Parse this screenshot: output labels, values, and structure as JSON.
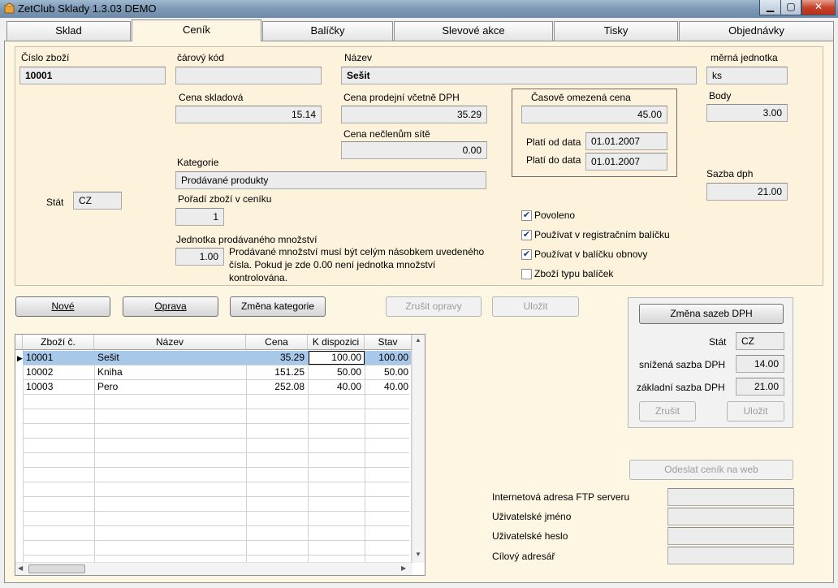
{
  "window": {
    "title": "ZetClub Sklady 1.3.03 DEMO"
  },
  "tabs": [
    "Sklad",
    "Ceník",
    "Balíčky",
    "Slevové akce",
    "Tisky",
    "Objednávky"
  ],
  "form": {
    "cislo_label": "Číslo zboží",
    "cislo_value": "10001",
    "carovy_label": "čárový kód",
    "carovy_value": "",
    "nazev_label": "Název",
    "nazev_value": "Sešit",
    "jednotka_label": "měrná jednotka",
    "jednotka_value": "ks",
    "cena_skladova_label": "Cena skladová",
    "cena_skladova_value": "15.14",
    "cena_prodejni_label": "Cena prodejní včetně DPH",
    "cena_prodejni_value": "35.29",
    "cena_necl_label": "Cena nečlenům sítě",
    "cena_necl_value": "0.00",
    "casove_label": "Časově omezená cena",
    "casove_value": "45.00",
    "plati_od_label": "Platí od data",
    "plati_od_value": "01.01.2007",
    "plati_do_label": "Platí do data",
    "plati_do_value": "01.01.2007",
    "body_label": "Body",
    "body_value": "3.00",
    "sazba_label": "Sazba dph",
    "sazba_value": "21.00",
    "kategorie_label": "Kategorie",
    "kategorie_value": "Prodávané produkty",
    "stat_label": "Stát",
    "stat_value": "CZ",
    "poradi_label": "Pořadí zboží v ceníku",
    "poradi_value": "1",
    "jpm_label": "Jednotka prodávaného množství",
    "jpm_value": "1.00",
    "jpm_note": "Prodávané množství musí být celým násobkem uvedeného čísla. Pokud je zde 0.00 není jednotka množství kontrolována.",
    "checkboxes": [
      {
        "label": "Povoleno",
        "checked": true
      },
      {
        "label": "Používat v registračním balíčku",
        "checked": true
      },
      {
        "label": "Používat v balíčku obnovy",
        "checked": true
      },
      {
        "label": "Zboží typu balíček",
        "checked": false
      }
    ]
  },
  "buttons": {
    "nove": "Nové",
    "oprava": "Oprava",
    "zmena_kategorie": "Změna kategorie",
    "zrusit_opravy": "Zrušit opravy",
    "ulozit": "Uložit"
  },
  "grid": {
    "columns": [
      "Zboží č.",
      "Název",
      "Cena",
      "K dispozici",
      "Stav"
    ],
    "rows": [
      [
        "10001",
        "Sešit",
        "35.29",
        "100.00",
        "100.00"
      ],
      [
        "10002",
        "Kniha",
        "151.25",
        "50.00",
        "50.00"
      ],
      [
        "10003",
        "Pero",
        "252.08",
        "40.00",
        "40.00"
      ]
    ],
    "selected_row": 0
  },
  "dph": {
    "button": "Změna sazeb DPH",
    "stat_label": "Stát",
    "stat_value": "CZ",
    "snizena_label": "snížená sazba DPH",
    "snizena_value": "14.00",
    "zakladni_label": "základní sazba DPH",
    "zakladni_value": "21.00",
    "zrusit": "Zrušit",
    "ulozit": "Uložit"
  },
  "web": {
    "button": "Odeslat ceník na web",
    "ftp_label": "Internetová adresa FTP serveru",
    "ftp_value": "",
    "user_label": "Uživatelské jméno",
    "user_value": "",
    "pass_label": "Uživatelské heslo",
    "pass_value": "",
    "dir_label": "Cílový adresář",
    "dir_value": ""
  },
  "colors": {
    "panel": "#fdf6e3",
    "selection": "#a8c8ea",
    "check": "#1e3c7a"
  }
}
